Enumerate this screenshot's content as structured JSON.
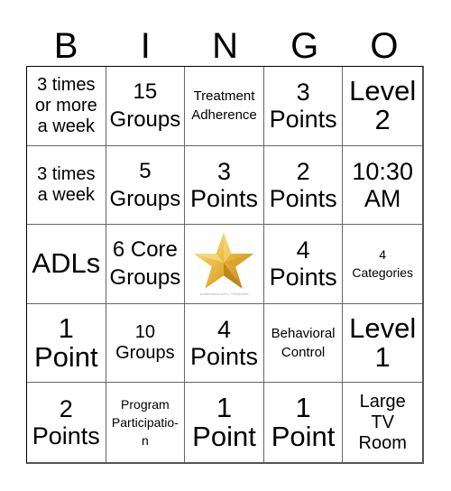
{
  "header": {
    "letters": [
      "B",
      "I",
      "N",
      "G",
      "O"
    ]
  },
  "cells": [
    {
      "text": "3 times\nor more\na week",
      "size": "s-sm"
    },
    {
      "text": "15\nGroups",
      "size": "s-m"
    },
    {
      "text": "Treatment\nAdherence",
      "size": "s-s"
    },
    {
      "text": "3\nPoints",
      "size": "s-l"
    },
    {
      "text": "Level\n2",
      "size": "s-xl"
    },
    {
      "text": "3 times\na week",
      "size": "s-sm"
    },
    {
      "text": "5\nGroups",
      "size": "s-m"
    },
    {
      "text": "3\nPoints",
      "size": "s-l"
    },
    {
      "text": "2\nPoints",
      "size": "s-l"
    },
    {
      "text": "10:30\nAM",
      "size": "s-l"
    },
    {
      "text": "ADLs",
      "size": "s-xl"
    },
    {
      "text": "6 Core\nGroups",
      "size": "s-m"
    },
    {
      "free": true,
      "icon": "gold-star-icon",
      "caption": "shutterstock.com • 753345289"
    },
    {
      "text": "4\nPoints",
      "size": "s-l"
    },
    {
      "text": "4\nCategories",
      "size": "s-xs"
    },
    {
      "text": "1\nPoint",
      "size": "s-xl"
    },
    {
      "text": "10\nGroups",
      "size": "s-sm"
    },
    {
      "text": "4\nPoints",
      "size": "s-l"
    },
    {
      "text": "Behavioral\nControl",
      "size": "s-s"
    },
    {
      "text": "Level\n1",
      "size": "s-xl"
    },
    {
      "text": "2\nPoints",
      "size": "s-l"
    },
    {
      "text": "Program\nParticipatio-\nn",
      "size": "s-xs"
    },
    {
      "text": "1\nPoint",
      "size": "s-xl"
    },
    {
      "text": "1\nPoint",
      "size": "s-xl"
    },
    {
      "text": "Large\nTV\nRoom",
      "size": "s-sm"
    }
  ],
  "colors": {
    "star_light": "#f7d86a",
    "star_dark": "#c8901a",
    "border": "#000000"
  }
}
